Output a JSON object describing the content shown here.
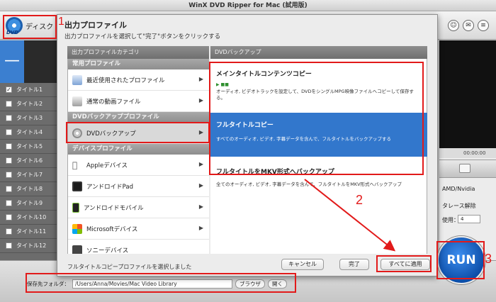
{
  "window": {
    "title": "WinX DVD Ripper for Mac (試用版)"
  },
  "toolbar": {
    "disc_label": "ディスク",
    "dvd_logo_text": "DVD"
  },
  "toolbar_icons": [
    "person-icon",
    "envelope-icon",
    "menu-icon"
  ],
  "title_list": {
    "items": [
      {
        "label": "タイトル1",
        "checked": true
      },
      {
        "label": "タイトル2",
        "checked": false
      },
      {
        "label": "タイトル3",
        "checked": false
      },
      {
        "label": "タイトル4",
        "checked": false
      },
      {
        "label": "タイトル5",
        "checked": false
      },
      {
        "label": "タイトル6",
        "checked": false
      },
      {
        "label": "タイトル7",
        "checked": false
      },
      {
        "label": "タイトル8",
        "checked": false
      },
      {
        "label": "タイトル9",
        "checked": false
      },
      {
        "label": "タイトル10",
        "checked": false
      },
      {
        "label": "タイトル11",
        "checked": false
      },
      {
        "label": "タイトル12",
        "checked": false
      }
    ],
    "check_mark": "✓",
    "minus_label": "—"
  },
  "right_panel": {
    "time_text": "00:00:00",
    "hw_text": "AMD/Nvidia",
    "deinterlace_text": "タレース解除",
    "use_label": "使用：",
    "use_value": "4"
  },
  "dialog": {
    "title": "出力プロファイル",
    "description": "出力プロファイルを選択して\"完了\"ボタンをクリックする",
    "category_header": "出力プロファイルカテゴリ",
    "profile_header": "DVDバックアップ",
    "groups": {
      "common": "常用プロファイル",
      "dvd_backup": "DVDバックアッププロファイル",
      "device": "デバイスプロファイル"
    },
    "categories": {
      "recent": "最近使用されたプロファイル",
      "normal_video": "通常の動画ファイル",
      "dvd_backup": "DVDバックアップ",
      "apple": "Appleデバイス",
      "android_pad": "アンドロイドPad",
      "android_mobile": "アンドロイドモバイル",
      "microsoft": "Microsoftデバイス",
      "sony": "ソニーデバイス"
    },
    "profiles": [
      {
        "title": "メインタイトルコンテンツコピー",
        "badge": "▶ ■■",
        "desc": "オーディオ, ビデオトラックを設定して、DVDをシングルMPG映像ファイルへコピーして保存する。"
      },
      {
        "title": "フルタイトルコピー",
        "desc": "すべてのオーディオ, ビデオ, 字幕データを含んで、フルタイトルをバックアップする"
      },
      {
        "title": "フルタイトルをMKV形式へバックアップ",
        "desc": "全てのオーディオ, ビデオ, 字幕データを含んで、フルタイトルをMKV形式へバックアップ"
      }
    ],
    "status": "フルタイトルコピープロファイルを選択しました",
    "buttons": {
      "cancel": "キャンセル",
      "done": "完了",
      "apply_all": "すべてに適用"
    }
  },
  "bottom": {
    "folder_label": "保存先フォルダ：",
    "folder_path": "/Users/Anna/Movies/Mac Video Library",
    "browse": "ブラウザ",
    "open": "開く",
    "run": "RUN"
  },
  "annotations": {
    "n1": "1",
    "n2": "2",
    "n3": "3",
    "color": "#e21a1a"
  }
}
